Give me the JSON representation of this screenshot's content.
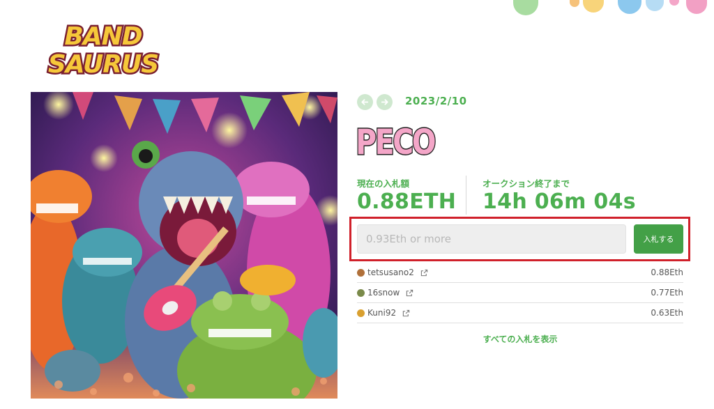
{
  "brand": {
    "logo_line1": "BAND",
    "logo_line2": "SAURUS"
  },
  "artwork": {
    "alt": "dinosaurs playing guitar"
  },
  "auction": {
    "nav_prev_icon": "arrow-left-icon",
    "nav_next_icon": "arrow-right-icon",
    "date": "2023/2/10",
    "title": "PECO",
    "current_bid_label": "現在の入札額",
    "current_bid_value": "0.88ETH",
    "time_left_label": "オークション終了まで",
    "time_left_value": "14h 06m 04s",
    "bid_placeholder": "0.93Eth or more",
    "bid_button_label": "入札する",
    "bids": [
      {
        "user": "tetsusano2",
        "amount": "0.88Eth",
        "avatar_color": "#b0703a"
      },
      {
        "user": "16snow",
        "amount": "0.77Eth",
        "avatar_color": "#7a8a4a"
      },
      {
        "user": "Kuni92",
        "amount": "0.63Eth",
        "avatar_color": "#d9a030"
      }
    ],
    "show_all_label": "すべての入札を表示"
  },
  "colors": {
    "accent": "#4caf50",
    "button": "#43a047",
    "highlight": "#d0202a",
    "title_fill": "#f4a6c8"
  }
}
